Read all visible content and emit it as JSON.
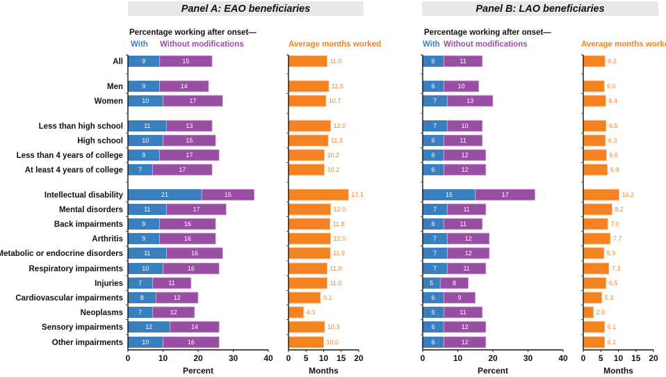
{
  "chart_data": {
    "type": "bar",
    "categories": [
      "All",
      "Men",
      "Women",
      "Less than high school",
      "High school",
      "Less than 4 years of college",
      "At least 4 years of college",
      "Intellectual disability",
      "Mental disorders",
      "Back impairments",
      "Arthritis",
      "Metabolic or endocrine disorders",
      "Respiratory impairments",
      "Injuries",
      "Cardiovascular impairments",
      "Neoplasms",
      "Sensory impairments",
      "Other impairments"
    ],
    "category_groups": [
      [
        0
      ],
      [
        1,
        2
      ],
      [
        3,
        4,
        5,
        6
      ],
      [
        7,
        8,
        9,
        10,
        11,
        12,
        13,
        14,
        15,
        16,
        17
      ]
    ],
    "legend": {
      "title": "Percentage working after onset—",
      "with": "With",
      "without": "Without modifications",
      "months": "Average months worked"
    },
    "colors": {
      "with": "#3a7fbf",
      "without": "#984ea3",
      "months": "#f58220"
    },
    "panels": [
      {
        "title": "Panel A: EAO beneficiaries",
        "percent": {
          "xlabel": "Percent",
          "xlim": [
            0,
            40
          ],
          "ticks": [
            "0",
            "10",
            "20",
            "30",
            "40"
          ],
          "series": [
            {
              "name": "With",
              "values": [
                9,
                9,
                10,
                11,
                10,
                9,
                7,
                21,
                11,
                9,
                9,
                11,
                10,
                7,
                8,
                7,
                12,
                10
              ]
            },
            {
              "name": "Without modifications",
              "values": [
                15,
                14,
                17,
                13,
                15,
                17,
                17,
                15,
                17,
                16,
                16,
                16,
                16,
                11,
                12,
                12,
                14,
                16
              ]
            }
          ]
        },
        "months": {
          "xlabel": "Months",
          "xlim": [
            0,
            20
          ],
          "ticks": [
            "0",
            "5",
            "10",
            "15",
            "20"
          ],
          "values": [
            "11.0",
            "11.5",
            "10.7",
            "12.0",
            "11.3",
            "10.2",
            "10.2",
            "17.1",
            "12.0",
            "11.8",
            "12.0",
            "11.9",
            "11.0",
            "11.0",
            "9.1",
            "4.3",
            "10.3",
            "10.0"
          ]
        }
      },
      {
        "title": "Panel B: LAO beneficiaries",
        "percent": {
          "xlabel": "Percent",
          "xlim": [
            0,
            40
          ],
          "ticks": [
            "0",
            "10",
            "20",
            "30",
            "40"
          ],
          "series": [
            {
              "name": "With",
              "values": [
                6,
                6,
                7,
                7,
                6,
                6,
                6,
                15,
                7,
                6,
                7,
                7,
                7,
                5,
                6,
                6,
                6,
                6
              ]
            },
            {
              "name": "Without modifications",
              "values": [
                11,
                10,
                13,
                10,
                11,
                12,
                12,
                17,
                11,
                11,
                12,
                12,
                11,
                8,
                9,
                11,
                12,
                12
              ]
            }
          ]
        },
        "months": {
          "xlabel": "Months",
          "xlim": [
            0,
            20
          ],
          "ticks": [
            "0",
            "5",
            "10",
            "15",
            "20"
          ],
          "values": [
            "6.2",
            "6.0",
            "6.4",
            "6.5",
            "6.3",
            "6.6",
            "6.9",
            "10.2",
            "8.2",
            "7.0",
            "7.7",
            "5.9",
            "7.3",
            "6.5",
            "5.3",
            "2.9",
            "6.1",
            "6.1"
          ]
        }
      }
    ]
  }
}
